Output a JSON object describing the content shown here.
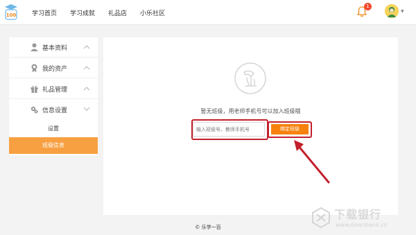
{
  "header": {
    "logo_text": "100",
    "nav": [
      "学习首页",
      "学习成就",
      "礼品店",
      "小乐社区"
    ],
    "notification_count": "1"
  },
  "sidebar": {
    "items": [
      {
        "label": "基本资料",
        "icon": "user-icon"
      },
      {
        "label": "我的资产",
        "icon": "medal-icon"
      },
      {
        "label": "礼品管理",
        "icon": "gift-icon"
      },
      {
        "label": "信息设置",
        "icon": "settings-icon"
      }
    ],
    "sub_items": [
      {
        "label": "设置",
        "active": false
      },
      {
        "label": "班级信息",
        "active": true
      }
    ]
  },
  "main": {
    "empty_message": "暂无班级，用老师手机号可以加入班级哦",
    "input_placeholder": "输入班级号、教师手机号",
    "bind_button": "绑定班级"
  },
  "footer": {
    "text": "© 乐学一百"
  },
  "watermark": {
    "title": "下载银行",
    "url": "www.downbank.cn"
  },
  "colors": {
    "accent": "#f7a042",
    "button": "#f7820d",
    "annotation": "#c3202c",
    "badge": "#f04a2f"
  }
}
